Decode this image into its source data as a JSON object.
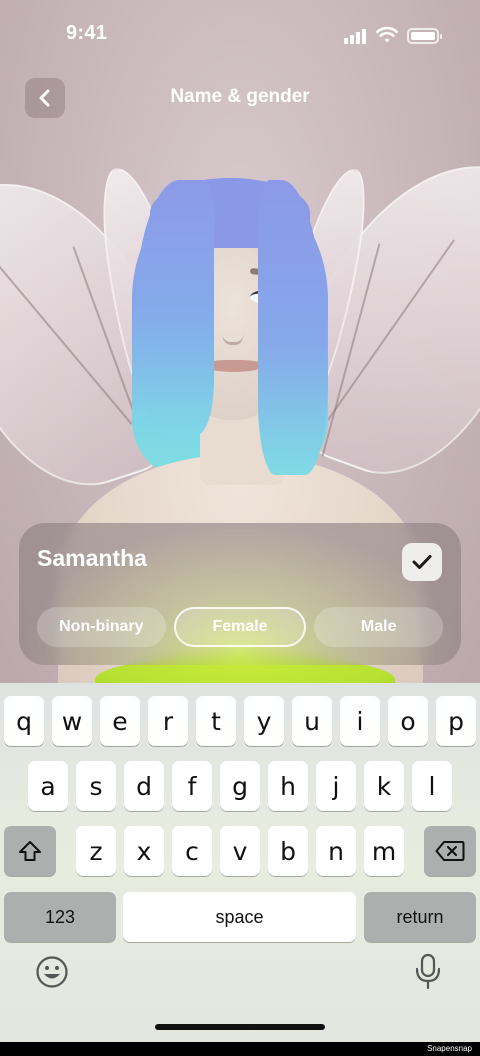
{
  "status_bar": {
    "time": "9:41"
  },
  "header": {
    "title": "Name & gender",
    "back_icon": "chevron-left-icon"
  },
  "name_card": {
    "name": "Samantha",
    "confirm_icon": "checkmark-icon",
    "genders": [
      {
        "label": "Non-binary",
        "selected": false
      },
      {
        "label": "Female",
        "selected": true
      },
      {
        "label": "Male",
        "selected": false
      }
    ]
  },
  "keyboard": {
    "row1": [
      "q",
      "w",
      "e",
      "r",
      "t",
      "y",
      "u",
      "i",
      "o",
      "p"
    ],
    "row2": [
      "a",
      "s",
      "d",
      "f",
      "g",
      "h",
      "j",
      "k",
      "l"
    ],
    "row3": [
      "z",
      "x",
      "c",
      "v",
      "b",
      "n",
      "m"
    ],
    "numbers_label": "123",
    "space_label": "space",
    "return_label": "return",
    "shift_icon": "shift-icon",
    "delete_icon": "delete-icon",
    "emoji_icon": "emoji-icon",
    "mic_icon": "microphone-icon"
  },
  "footer": {
    "watermark": "Snapensnap"
  }
}
